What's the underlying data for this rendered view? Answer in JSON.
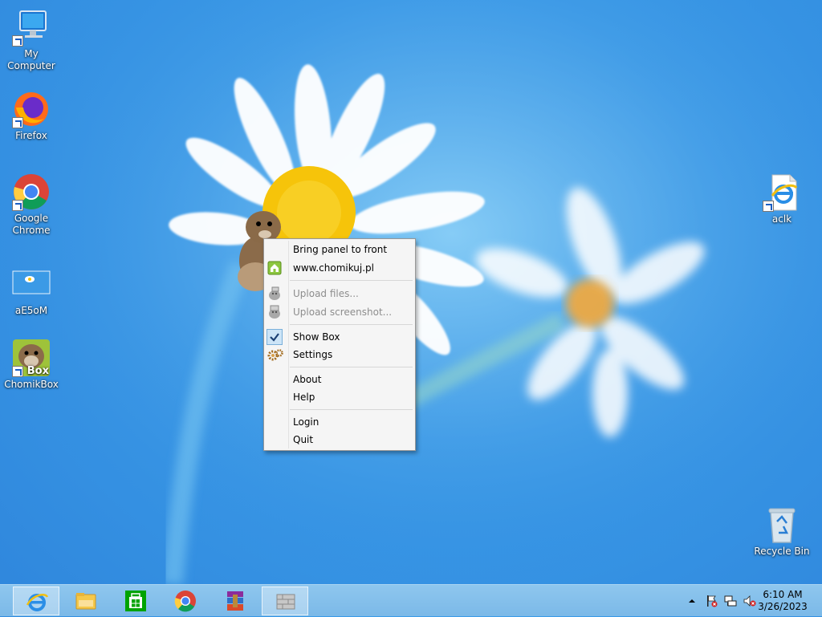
{
  "desktop": {
    "icons": [
      {
        "label": "My Computer"
      },
      {
        "label": "Firefox"
      },
      {
        "label": "Google Chrome"
      },
      {
        "label": "aE5oM"
      },
      {
        "label": "ChomikBox"
      },
      {
        "label": "aclk"
      },
      {
        "label": "Recycle Bin"
      }
    ],
    "chomikbox_badge": "Box"
  },
  "context_menu": {
    "items": [
      {
        "label": "Bring panel to front",
        "enabled": true
      },
      {
        "label": "www.chomikuj.pl",
        "enabled": true,
        "icon": "home-icon"
      },
      {
        "label": "Upload files...",
        "enabled": false,
        "icon": "upload-icon"
      },
      {
        "label": "Upload screenshot...",
        "enabled": false,
        "icon": "screenshot-icon"
      },
      {
        "label": "Show Box",
        "enabled": true,
        "checked": true
      },
      {
        "label": "Settings",
        "enabled": true,
        "icon": "gears-icon"
      },
      {
        "label": "About",
        "enabled": true
      },
      {
        "label": "Help",
        "enabled": true
      },
      {
        "label": "Login",
        "enabled": true
      },
      {
        "label": "Quit",
        "enabled": true
      }
    ]
  },
  "taskbar": {
    "buttons": [
      {
        "icon": "internet-explorer-icon"
      },
      {
        "icon": "file-explorer-icon"
      },
      {
        "icon": "store-icon"
      },
      {
        "icon": "chrome-icon"
      },
      {
        "icon": "winrar-icon"
      },
      {
        "icon": "chomikbox-icon"
      }
    ],
    "clock": {
      "time": "6:10 AM",
      "date": "3/26/2023"
    }
  },
  "colors": {
    "accent": "#3a9be8",
    "taskbar": "#84bfea",
    "menu_bg": "#f5f5f5"
  }
}
